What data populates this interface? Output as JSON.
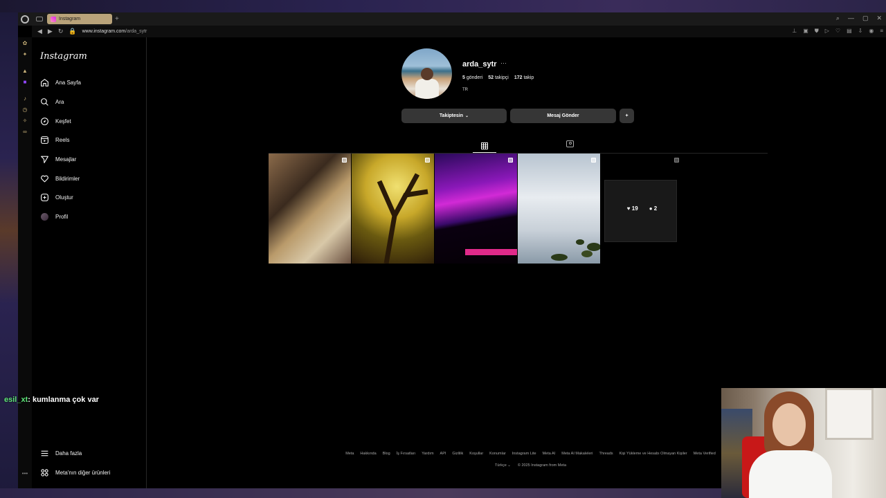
{
  "browser": {
    "tab_title": "Instagram",
    "url_host": "www.instagram.com",
    "url_path": "/arda_sytr"
  },
  "nav": {
    "logo": "Instagram",
    "items": [
      {
        "label": "Ana Sayfa",
        "icon": "home-icon"
      },
      {
        "label": "Ara",
        "icon": "search-icon"
      },
      {
        "label": "Keşfet",
        "icon": "compass-icon"
      },
      {
        "label": "Reels",
        "icon": "reels-icon"
      },
      {
        "label": "Mesajlar",
        "icon": "send-icon"
      },
      {
        "label": "Bildirimler",
        "icon": "heart-icon"
      },
      {
        "label": "Oluştur",
        "icon": "plus-square-icon"
      },
      {
        "label": "Profil",
        "icon": "avatar-icon"
      }
    ],
    "more": "Daha fazla",
    "meta_products": "Meta'nın diğer ürünleri"
  },
  "profile": {
    "username": "arda_sytr",
    "more": "···",
    "posts_count": "5",
    "posts_label": "gönderi",
    "followers_count": "52",
    "followers_label": "takipçi",
    "following_count": "172",
    "following_label": "takip",
    "bio": "TR",
    "follow_button": "Takiptesin",
    "message_button": "Mesaj Gönder",
    "suggest_button": "+"
  },
  "posts": [
    {
      "type": "multi",
      "colors": [
        "#6a5340",
        "#c9b38c"
      ]
    },
    {
      "type": "multi",
      "colors": [
        "#2a1a08",
        "#d8c23a"
      ]
    },
    {
      "type": "multi",
      "colors": [
        "#3a0a6a",
        "#d22ad6"
      ]
    },
    {
      "type": "multi",
      "colors": [
        "#cfd5dc",
        "#6a7a8a"
      ]
    },
    {
      "type": "multi",
      "colors": [
        "#111",
        "#222"
      ],
      "likes": "19",
      "comments": "2"
    }
  ],
  "footer": {
    "links": [
      "Meta",
      "Hakkında",
      "Blog",
      "İş Fırsatları",
      "Yardım",
      "API",
      "Gizlilik",
      "Koşullar",
      "Konumlar",
      "Instagram Lite",
      "Meta AI",
      "Meta AI Makaleleri",
      "Threads",
      "Kişi Yükleme ve Hesabı Olmayan Kişiler",
      "Meta Verified"
    ],
    "language": "Türkçe",
    "copyright": "© 2025 Instagram from Meta"
  },
  "chat": {
    "user": "esil_xt",
    "message": ": kumlanma çok var"
  }
}
